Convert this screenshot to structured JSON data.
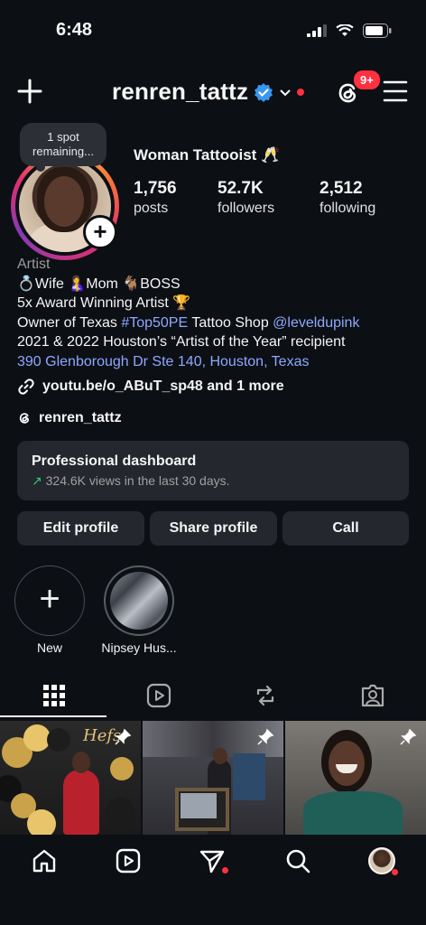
{
  "status_bar": {
    "time": "6:48"
  },
  "header": {
    "username": "renren_tattz",
    "notification_badge": "9+"
  },
  "profile": {
    "note": "1 spot remaining...",
    "category_line": "Woman Tattooist 🥂",
    "stats": [
      {
        "value": "1,756",
        "label": "posts"
      },
      {
        "value": "52.7K",
        "label": "followers"
      },
      {
        "value": "2,512",
        "label": "following"
      }
    ]
  },
  "bio": {
    "category": "Artist",
    "line1": "💍Wife 🤱Mom 🐐BOSS",
    "line2": "5x Award Winning Artist 🏆",
    "line3_pre": "Owner of Texas ",
    "line3_tag": "#Top50PE",
    "line3_mid": " Tattoo Shop ",
    "line3_mention": "@leveldupink",
    "line4": "2021 & 2022 Houston’s “Artist of the Year” recipient",
    "address": "390 Glenborough Dr Ste 140, Houston, Texas",
    "links": "youtu.be/o_ABuT_sp48 and 1 more",
    "threads_handle": "renren_tattz"
  },
  "dashboard": {
    "title": "Professional dashboard",
    "subtitle": "324.6K views in the last 30 days."
  },
  "actions": {
    "edit": "Edit profile",
    "share": "Share profile",
    "call": "Call"
  },
  "highlights": [
    {
      "label": "New"
    },
    {
      "label": "Nipsey Hus..."
    }
  ],
  "tile1_text": "Hefs",
  "colors": {
    "accent_red": "#ff3040",
    "verified_blue": "#3897f0",
    "link": "#8ea8ff"
  }
}
